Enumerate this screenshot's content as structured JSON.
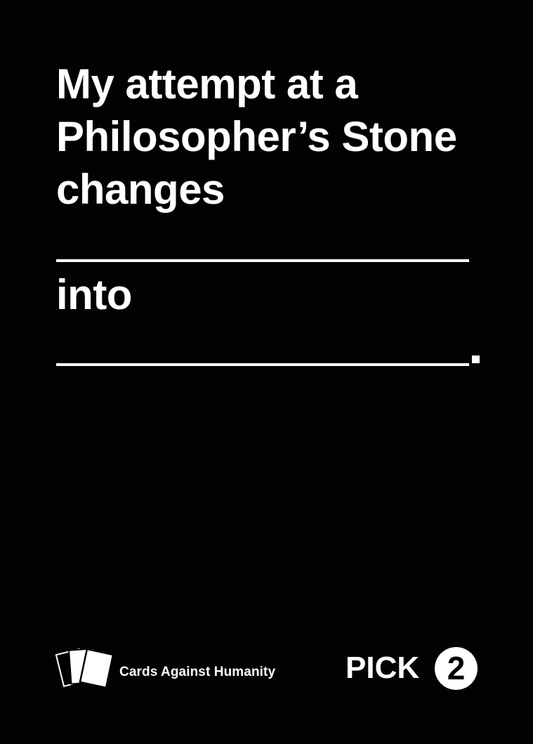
{
  "card": {
    "prompt_lines": [
      "My attempt at a",
      "Philosopher’s Stone",
      "changes"
    ],
    "middle_word": "into",
    "end_punctuation": "."
  },
  "footer": {
    "brand": "Cards Against Humanity",
    "pick_label": "PICK",
    "pick_count": "2",
    "logo_icon": "stacked-cards-icon"
  },
  "colors": {
    "background": "#000000",
    "foreground": "#ffffff"
  }
}
